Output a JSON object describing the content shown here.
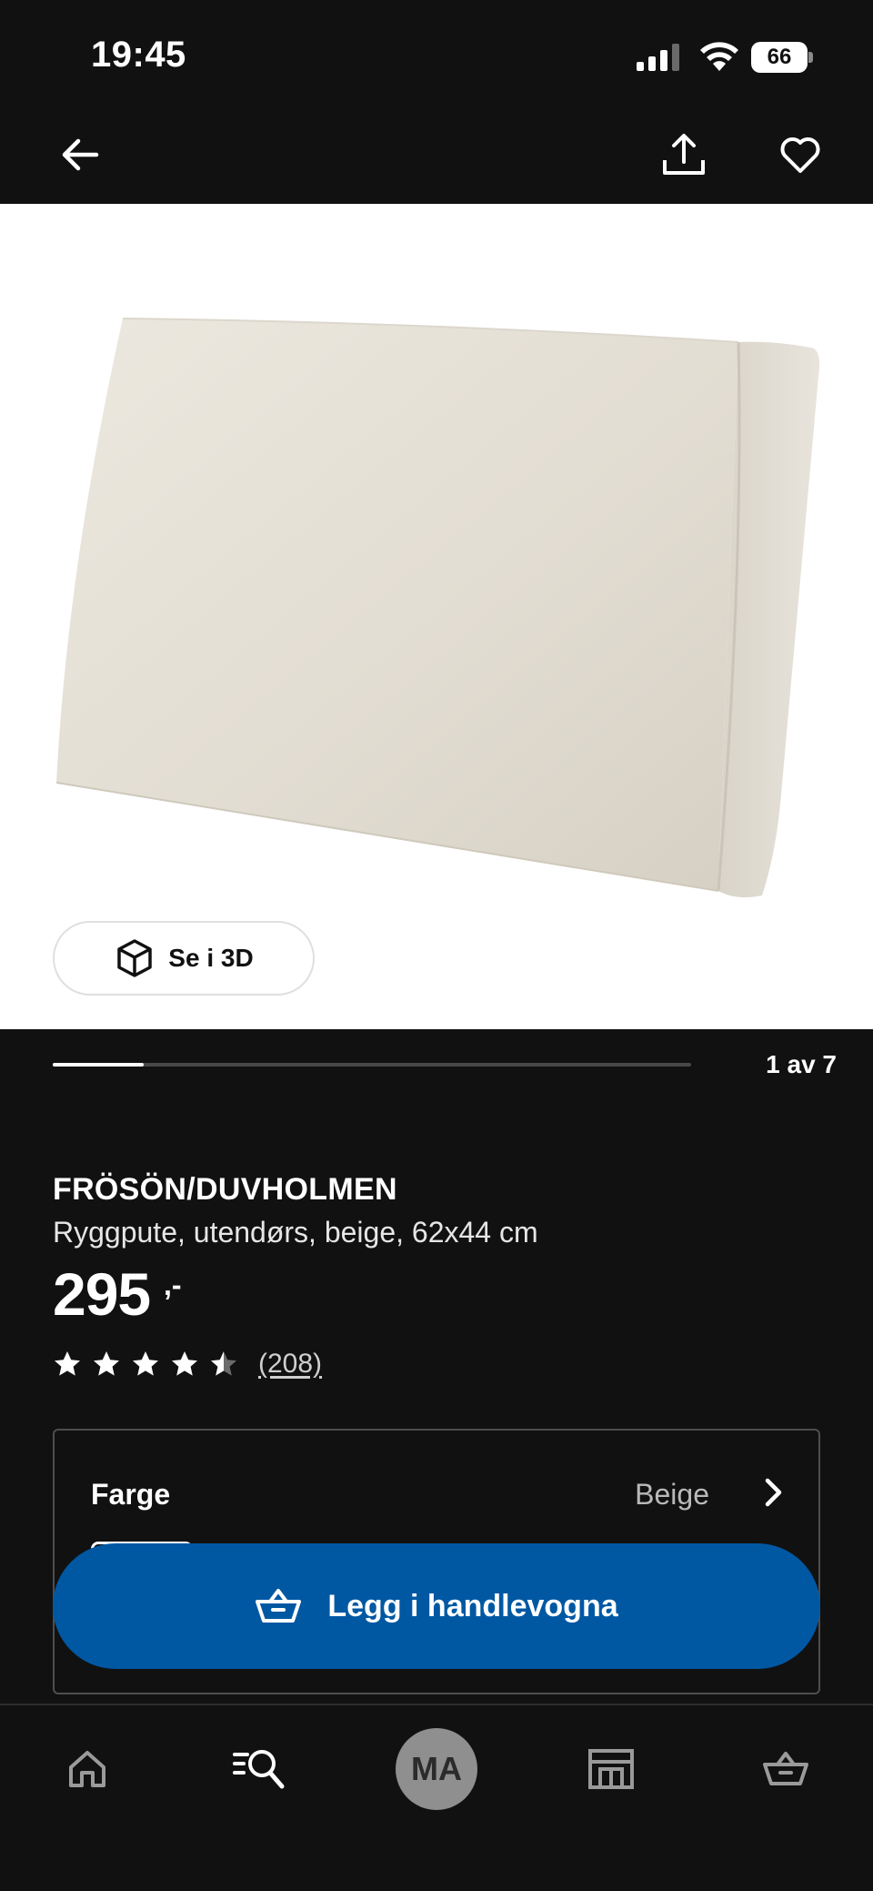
{
  "status_bar": {
    "time": "19:45",
    "battery_level": "66"
  },
  "top_nav": {
    "back_icon": "arrow-left-icon",
    "share_icon": "share-upload-icon",
    "favorite_icon": "heart-outline-icon"
  },
  "gallery": {
    "see_3d_label": "Se i 3D",
    "see_3d_icon": "cube-3d-icon",
    "pager_text": "1 av 7",
    "current_index": 1,
    "total": 7
  },
  "product": {
    "name": "FRÖSÖN/DUVHOLMEN",
    "description": "Ryggpute, utendørs, beige, 62x44 cm",
    "price": "295",
    "price_suffix": ",-",
    "rating": 4.5,
    "review_count": "(208)"
  },
  "variant": {
    "label": "Farge",
    "value": "Beige",
    "chevron_icon": "chevron-right-icon"
  },
  "cart_button": {
    "label": "Legg i handlevogna",
    "icon": "shopping-basket-icon",
    "color": "#0058a3"
  },
  "bottom_nav": {
    "home_icon": "home-icon",
    "search_icon": "search-list-icon",
    "profile_initials": "MA",
    "store_icon": "store-icon",
    "cart_icon": "shopping-basket-icon"
  }
}
